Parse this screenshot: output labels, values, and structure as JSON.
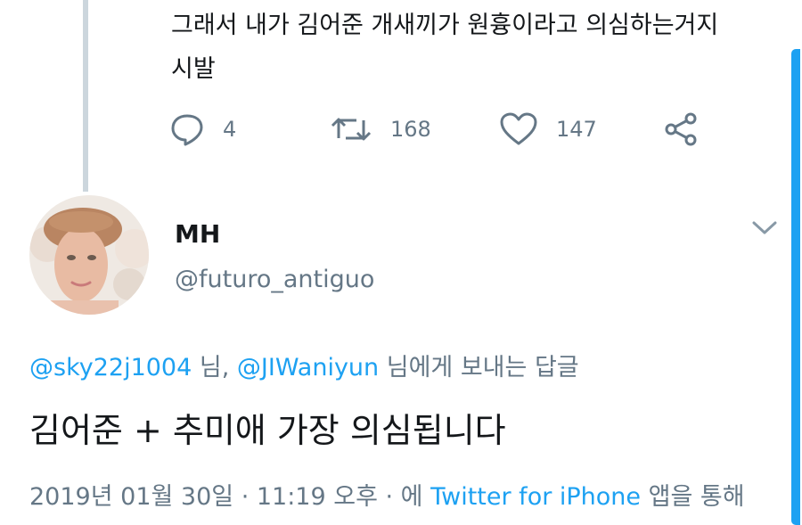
{
  "previous_tweet": {
    "lines": [
      "그래서 내가 김어준 개새끼가 원흉이라고 의심하는거지",
      "시발"
    ],
    "actions": {
      "reply_count": "4",
      "retweet_count": "168",
      "like_count": "147"
    }
  },
  "tweet": {
    "author": {
      "name": "MH",
      "handle": "@futuro_antiguo"
    },
    "replying_to": {
      "mention1": "@sky22j1004",
      "suffix1": " 님, ",
      "mention2": "@JIWaniyun",
      "suffix2": " 님에게 보내는 답글"
    },
    "text": "김어준 + 추미애 가장 의심됩니다",
    "meta": {
      "prefix": "2019년 01월 30일 · 11:19 오후 · 에 ",
      "source": "Twitter for iPhone",
      "suffix": " 앱을 통해"
    }
  },
  "icons": [
    "reply-icon",
    "retweet-icon",
    "like-icon",
    "share-icon",
    "chevron-down-icon"
  ],
  "colors": {
    "link": "#1da1f2",
    "secondary_text": "#657786",
    "thread_line": "#ccd6dd"
  }
}
